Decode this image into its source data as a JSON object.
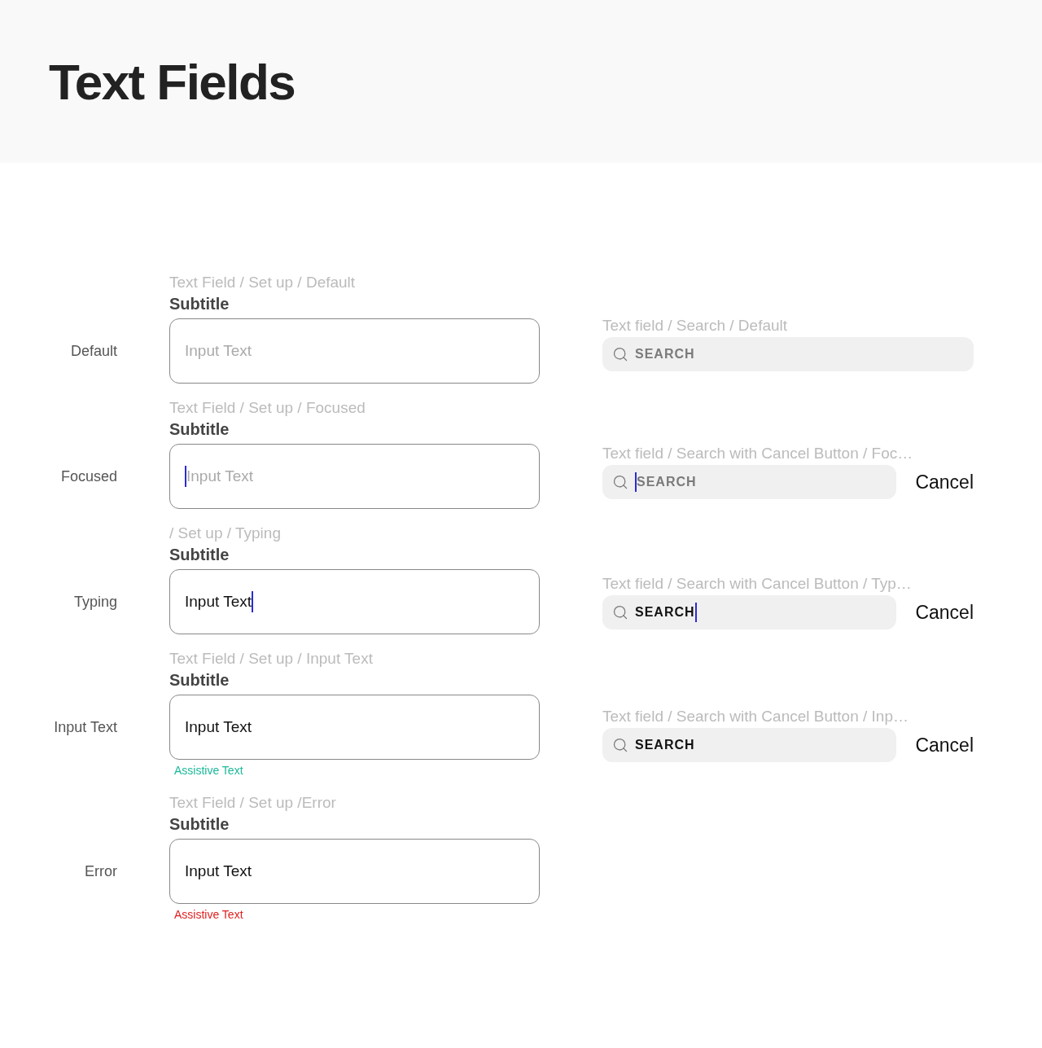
{
  "title": "Text Fields",
  "rows": [
    {
      "label": "Default",
      "caption": "Text Field / Set up / Default",
      "subtitle": "Subtitle",
      "field": {
        "placeholder": "Input Text",
        "focused": false
      },
      "search": {
        "caption": "Text field / Search / Default",
        "placeholder": "SEARCH",
        "focused": false
      }
    },
    {
      "label": "Focused",
      "caption": "Text Field / Set up / Focused",
      "subtitle": "Subtitle",
      "field": {
        "placeholder": "Input Text",
        "focused": true
      },
      "search": {
        "caption": "Text field / Search with Cancel Button / Foc…",
        "placeholder": "SEARCH",
        "focused": true,
        "cancel": "Cancel"
      }
    },
    {
      "label": "Typing",
      "caption": "/ Set up / Typing",
      "subtitle": "Subtitle",
      "field": {
        "value": "Input Text",
        "focused": true
      },
      "search": {
        "caption": "Text field / Search with Cancel Button  / Typ…",
        "value": "SEARCH",
        "focused": true,
        "cancel": "Cancel"
      }
    },
    {
      "label": "Input Text",
      "caption": "Text Field / Set up / Input Text",
      "subtitle": "Subtitle",
      "field": {
        "value": "Input Text",
        "focused": false
      },
      "assistive": {
        "text": "Assistive Text",
        "error": false
      },
      "search": {
        "caption": "Text field / Search with Cancel Button  / Inp…",
        "value": "SEARCH",
        "focused": false,
        "cancel": "Cancel"
      }
    },
    {
      "label": "Error",
      "caption": "Text Field / Set up /Error",
      "subtitle": "Subtitle",
      "field": {
        "value": "Input Text",
        "focused": false
      },
      "assistive": {
        "text": "Assistive Text",
        "error": true
      }
    }
  ]
}
